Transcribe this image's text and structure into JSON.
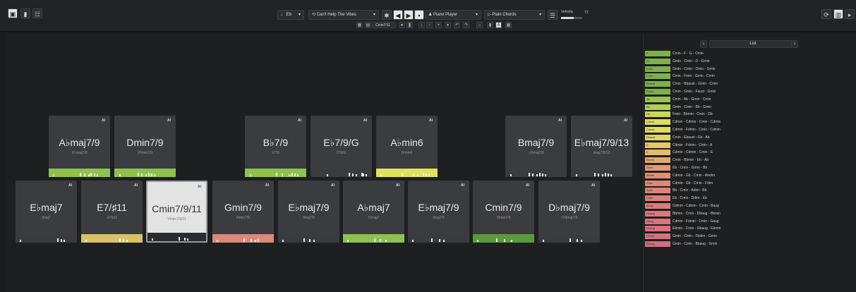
{
  "toolbar": {
    "key": "Eb",
    "preset": "Can't Help The Vibes",
    "player": "Piano Player",
    "style": "Plain Chords",
    "velocity_label": "Velocity",
    "velocity_value": "72",
    "sub_select": "Cmin7/11"
  },
  "pads_row1": [
    {
      "name": "A♭maj7/9",
      "sub": "IV♭maj7/9",
      "ai": "AI",
      "color": "#8fc14c",
      "bars": [
        3,
        40,
        46,
        52,
        55,
        60,
        64
      ]
    },
    {
      "name": "Dmin7/9",
      "sub": "VIImin7/9",
      "ai": "AI",
      "color": "#8fc14c",
      "bars": [
        4,
        30,
        35,
        40,
        44,
        48,
        52
      ]
    },
    {
      "name": "B♭7/9",
      "sub": "V7/9",
      "ai": "AI",
      "color": "#8fc14c",
      "bars": [
        4,
        40,
        48,
        58,
        62,
        66,
        70
      ]
    },
    {
      "name": "E♭7/9/G",
      "sub": "I7/9/G",
      "ai": "AI",
      "color": "#3a3b3e",
      "bars": [
        20,
        50,
        55,
        60,
        68,
        70,
        74
      ]
    },
    {
      "name": "A♭min6",
      "sub": "IVmin6",
      "ai": "AI",
      "color": "#dfe15d",
      "bars": [
        3,
        33,
        48,
        54,
        62,
        66,
        70
      ]
    },
    {
      "name": "Bmaj7/9",
      "sub": "♭VImaj7/9",
      "ai": "AI",
      "color": "#3a3b3e",
      "bars": [
        4,
        30,
        35,
        40,
        44,
        48,
        52
      ]
    },
    {
      "name": "E♭maj7/9/13",
      "sub": "Imaj7/9/13",
      "ai": "AI",
      "color": "#3a3b3e",
      "bars": [
        4,
        30,
        35,
        40,
        44,
        48,
        52
      ]
    }
  ],
  "pads_row2": [
    {
      "name": "E♭maj7",
      "sub": "Imaj7",
      "ai": "AI",
      "color": "#3a3b3e",
      "bars": [
        3,
        55,
        60,
        64
      ]
    },
    {
      "name": "E7/♯11",
      "sub": "♭I7/♯11",
      "ai": "AI",
      "color": "#d8c265",
      "bars": [
        3,
        50,
        55,
        60
      ]
    },
    {
      "name": "Cmin7/9/11",
      "sub": "VImin7/9/11",
      "ai": "AI",
      "color": "#2b2c2f",
      "bars": [
        3,
        40,
        48,
        52
      ]
    },
    {
      "name": "Gmin7/9",
      "sub": "IIImin7/9",
      "ai": "AI",
      "color": "#d9887a",
      "bars": [
        3,
        40,
        50,
        56,
        60
      ]
    },
    {
      "name": "E♭maj7/9",
      "sub": "Imaj7/9",
      "ai": "AI",
      "color": "#3a3b3e",
      "bars": [
        3,
        33,
        40,
        46
      ]
    },
    {
      "name": "A♭maj7",
      "sub": "IVmaj7",
      "ai": "AI",
      "color": "#8fc14c",
      "bars": [
        3,
        40,
        48,
        56
      ]
    },
    {
      "name": "E♭maj7/9",
      "sub": "Imaj7/9",
      "ai": "AI",
      "color": "#3a3b3e",
      "bars": [
        3,
        30,
        40,
        46
      ]
    },
    {
      "name": "Cmin7/9",
      "sub": "VImin7/9",
      "ai": "AI",
      "color": "#5a9a3a",
      "bars": [
        3,
        30,
        40,
        50
      ]
    },
    {
      "name": "D♭maj7/9",
      "sub": "♭VIImaj7/9",
      "ai": "AI",
      "color": "#3a3b3e",
      "bars": [
        3,
        40,
        50,
        56
      ]
    }
  ],
  "sidebar": {
    "list_label": "List",
    "rows": [
      {
        "k": "F",
        "t": "Cmin - F - G - Cmin",
        "c": "#7fb04a"
      },
      {
        "k": "G",
        "t": "Gmin - Cmin - D - Gmin",
        "c": "#7fb04a"
      },
      {
        "k": "Dmin",
        "t": "Gmin - Cmin - Dmin - Gmin",
        "c": "#7fb04a"
      },
      {
        "k": "Fmin",
        "t": "Cmin - Fmin - Gmin - Cmin",
        "c": "#7fb04a"
      },
      {
        "k": "Bbaust",
        "t": "Cmin - Bbaust - Gmin - Cmin",
        "c": "#7fb04a"
      },
      {
        "k": "Faust",
        "t": "Cmin - Gmin - Faust - Gmin",
        "c": "#7fb04a"
      },
      {
        "k": "Ab",
        "t": "Cmin - Ab - Gmin - Cmin",
        "c": "#9cc24e"
      },
      {
        "k": "Bb",
        "t": "Gmin - Cmin - Bb - Gmin",
        "c": "#b4d052"
      },
      {
        "k": "Db",
        "t": "Fmin - Bbmin - Cmin - Db",
        "c": "#cbd957"
      },
      {
        "k": "Cdmin",
        "t": "Cdmin - Cdmin - Cmin - Cdmin",
        "c": "#dce05a"
      },
      {
        "k": "Cdmin",
        "t": "Cdmin - Fdmin - Cmin - Cdmin",
        "c": "#e1dc60"
      },
      {
        "k": "Ebaust",
        "t": "Cmin - Ebaust - Eb - Ab",
        "c": "#e2d460"
      },
      {
        "k": "A",
        "t": "Cdmin - Fdmin - Cmin - A",
        "c": "#e4c966"
      },
      {
        "k": "E",
        "t": "Cdmin - Cdmin - Cmin - E",
        "c": "#e3bd6a"
      },
      {
        "k": "Bbmin",
        "t": "Cmin - Bbmin - Eb - Ab",
        "c": "#e2a870"
      },
      {
        "k": "Gmin",
        "t": "Eb - Cmin - Gmin - Bb",
        "c": "#e29a72"
      },
      {
        "k": "Abdim",
        "t": "Cdmin - Gb - Cmin - Abdim",
        "c": "#e08f75"
      },
      {
        "k": "Fdim",
        "t": "Cdmin - Gb - Cmin - Fdim",
        "c": "#de8877"
      },
      {
        "k": "Adim",
        "t": "Bb - Cmin - Adim - Bb",
        "c": "#dc8479"
      },
      {
        "k": "Ddim",
        "t": "Eb - Cmin - Ddim - Eb",
        "c": "#da807a"
      },
      {
        "k": "Baug",
        "t": "Gdmin - Cdmin - Cmin - Baug",
        "c": "#d97c7b"
      },
      {
        "k": "Dbaug",
        "t": "Bbmin - Cmin - Dbaug - Bbmin",
        "c": "#d8797c"
      },
      {
        "k": "Gaug",
        "t": "Cdmin - Fdmin - Cmin - Gaug",
        "c": "#d7767d"
      },
      {
        "k": "Gbaug",
        "t": "Ebmin - Cmin - Gbaug - Ebmin",
        "c": "#d6737e"
      },
      {
        "k": "Fbdim",
        "t": "Gmin - Cmin - Fbdim - Gmin",
        "c": "#d5707f"
      },
      {
        "k": "Bbaug",
        "t": "Gmin - Cmin - Bbaug - Gmin",
        "c": "#d46d80"
      }
    ]
  }
}
